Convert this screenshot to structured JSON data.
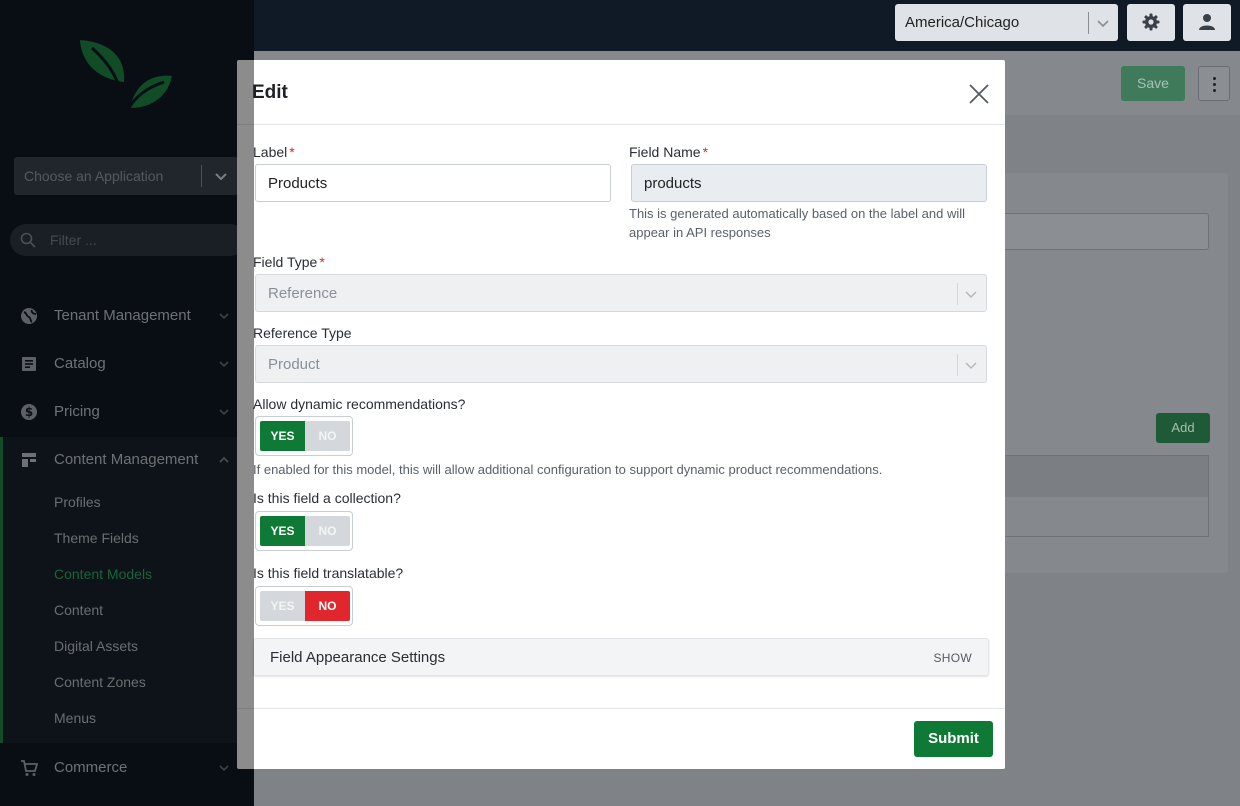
{
  "sidebar": {
    "app_select_placeholder": "Choose an Application",
    "filter_placeholder": "Filter ...",
    "nav": [
      {
        "label": "Tenant Management",
        "icon": "globe-icon"
      },
      {
        "label": "Catalog",
        "icon": "catalog-icon"
      },
      {
        "label": "Pricing",
        "icon": "dollar-icon"
      },
      {
        "label": "Content Management",
        "icon": "layout-icon"
      },
      {
        "label": "Commerce",
        "icon": "cart-icon"
      }
    ],
    "content_management_items": [
      {
        "label": "Profiles"
      },
      {
        "label": "Theme Fields"
      },
      {
        "label": "Content Models",
        "active": true
      },
      {
        "label": "Content"
      },
      {
        "label": "Digital Assets"
      },
      {
        "label": "Content Zones"
      },
      {
        "label": "Menus"
      }
    ]
  },
  "topbar": {
    "timezone": "America/Chicago",
    "settings_icon": "gear-icon",
    "user_icon": "user-icon"
  },
  "background_page": {
    "save_label": "Save",
    "add_label": "Add"
  },
  "modal": {
    "title": "Edit",
    "label_field": {
      "label": "Label",
      "value": "Products"
    },
    "field_name": {
      "label": "Field Name",
      "value": "products",
      "help": "This is generated automatically based on the label and will appear in API responses"
    },
    "field_type": {
      "label": "Field Type",
      "value": "Reference"
    },
    "reference_type": {
      "label": "Reference Type",
      "value": "Product"
    },
    "dynamic_recommendations": {
      "label": "Allow dynamic recommendations?",
      "yes": "YES",
      "no": "NO",
      "value": "YES",
      "help": "If enabled for this model, this will allow additional configuration to support dynamic product recommendations."
    },
    "collection": {
      "label": "Is this field a collection?",
      "yes": "YES",
      "no": "NO",
      "value": "YES"
    },
    "translatable": {
      "label": "Is this field translatable?",
      "yes": "YES",
      "no": "NO",
      "value": "NO"
    },
    "appearance": {
      "title": "Field Appearance Settings",
      "toggle": "SHOW"
    },
    "submit_label": "Submit"
  },
  "colors": {
    "brand_green": "#0f7a35",
    "danger_red": "#e0272e",
    "sidebar_bg": "#0f1a26"
  }
}
